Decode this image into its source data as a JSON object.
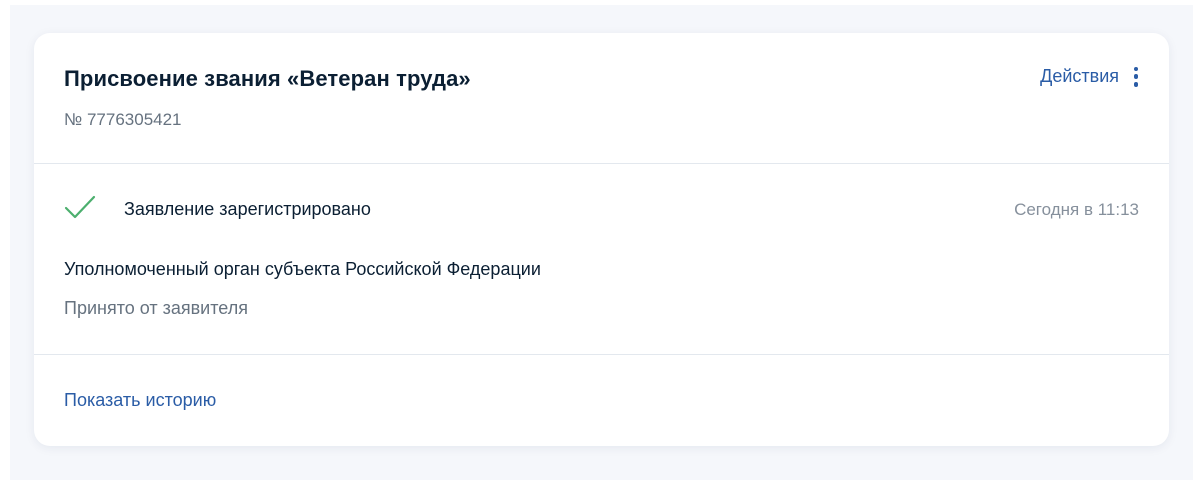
{
  "card": {
    "title": "Присвоение звания «Ветеран труда»",
    "number": "№ 7776305421",
    "actions_label": "Действия",
    "actions_icon": "kebab-menu-icon"
  },
  "status": {
    "icon": "check-icon",
    "icon_color": "#4caf6e",
    "text": "Заявление зарегистрировано",
    "time": "Сегодня в 11:13",
    "org_name": "Уполномоченный орган субъекта Российской Федерации",
    "org_note": "Принято от заявителя"
  },
  "footer": {
    "history_link": "Показать историю"
  },
  "colors": {
    "accent": "#2a5ca6",
    "text_primary": "#0b1f33",
    "text_secondary": "#66727f",
    "background": "#f5f7fb"
  }
}
